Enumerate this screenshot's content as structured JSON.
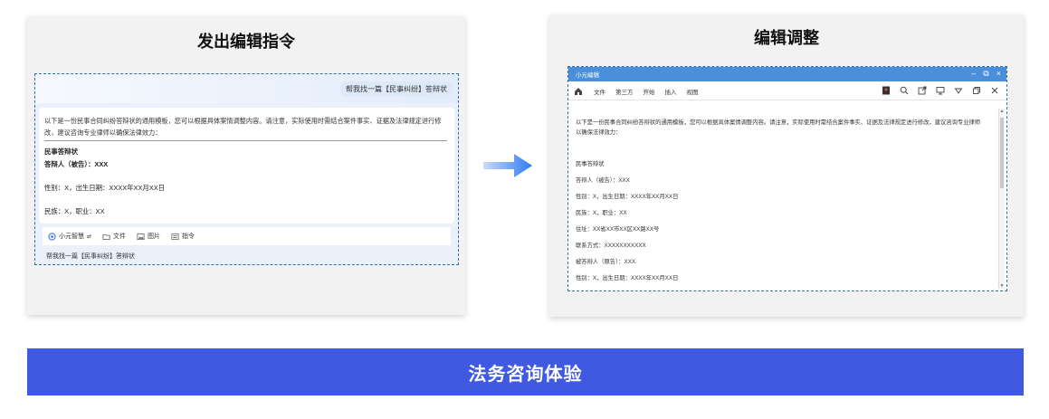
{
  "left_panel": {
    "title": "发出编辑指令",
    "user_message": "帮我找一篇【民事纠纷】答辩状",
    "ai_intro": "以下是一份民事合同纠纷答辩状的通用模板，您可以根据具体案情调整内容。请注意，实际使用时需结合案件事实、证据及法律规定进行修改，建议咨询专业律师以确保法律效力：",
    "doc_lines": [
      "民事答辩状",
      "答辩人（被告）：XXX",
      "性别：X，出生日期：XXXX年XX月XX日",
      "民族：X，职业：XX"
    ],
    "toolbar": {
      "assistant": "小元智慧",
      "file": "文件",
      "image": "图片",
      "command": "指令"
    },
    "input_text": "帮我找一篇【民事纠纷】答辩状"
  },
  "right_panel": {
    "title": "编辑调整",
    "window_title": "小元编辑",
    "menu": [
      "文件",
      "第三方",
      "开始",
      "插入",
      "视图"
    ],
    "body_lines": [
      "以下是一份民事合同纠纷答辩状的通用模板，您可以根据具体案情调整内容。请注意，实际使用时需结合案件事实、证据及法律规定进行修改，建议咨询专业律师",
      "以确保法律效力：",
      "民事答辩状",
      "答辩人（被告）：XXX",
      "性别：X，出生日期：XXXX年XX月XX日",
      "民族：X，职业：XX",
      "住址：XX省XX市XX区XX路XX号",
      "联系方式：XXXXXXXXXXX",
      "被答辩人（原告）：XXX",
      "性别：X，出生日期：XXXX年XX月XX日"
    ]
  },
  "banner": {
    "text": "法务咨询体验"
  },
  "colors": {
    "accent": "#3f5ae0",
    "titlebar": "#4a8fd9",
    "dashed_border": "#2f6fb0"
  }
}
